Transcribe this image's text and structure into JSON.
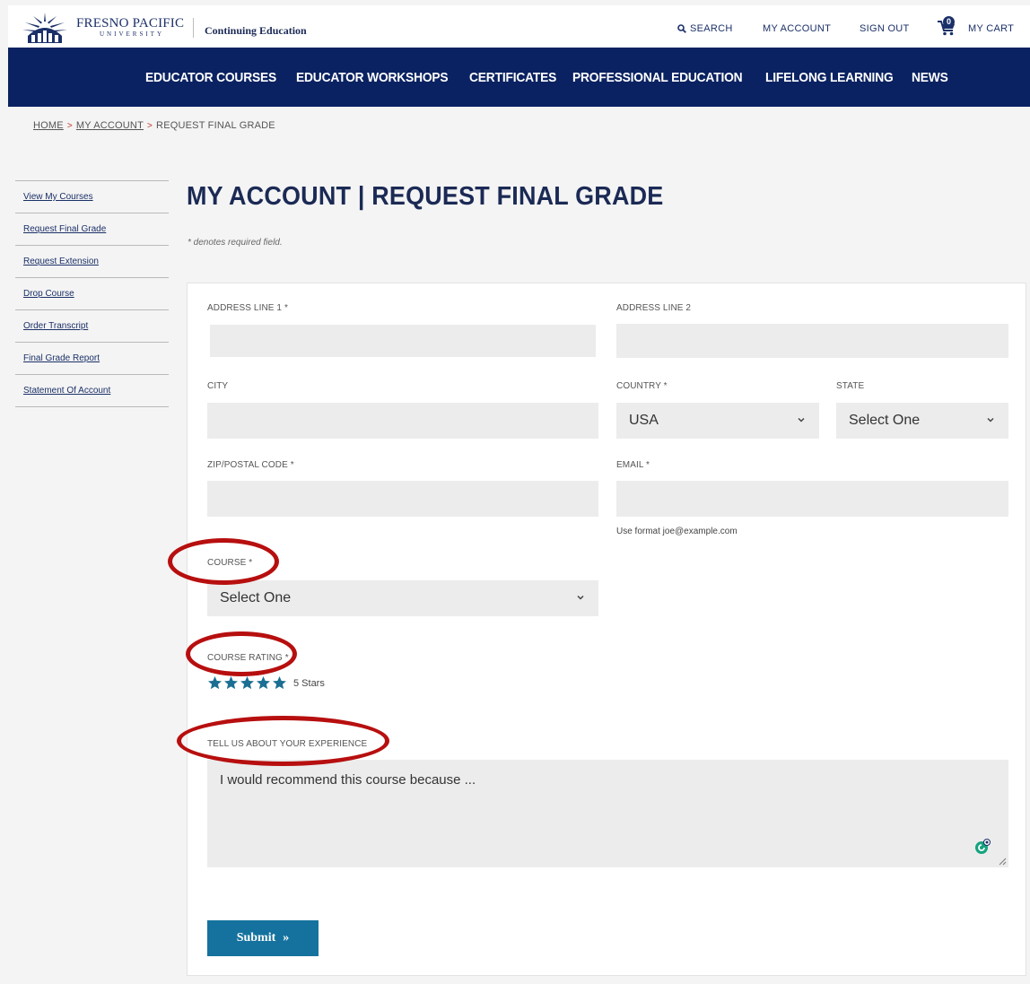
{
  "header": {
    "logo_name": "FRESNO PACIFIC",
    "logo_sub": "UNIVERSITY",
    "division": "Continuing Education",
    "search_label": "SEARCH",
    "account_label": "MY ACCOUNT",
    "signout_label": "SIGN OUT",
    "cart_label": "MY CART",
    "cart_count": "0"
  },
  "nav": {
    "items": [
      {
        "label": "EDUCATOR COURSES"
      },
      {
        "label": "EDUCATOR WORKSHOPS"
      },
      {
        "label": "CERTIFICATES"
      },
      {
        "label": "PROFESSIONAL EDUCATION"
      },
      {
        "label": "LIFELONG LEARNING"
      },
      {
        "label": "NEWS"
      }
    ]
  },
  "breadcrumb": {
    "home": "HOME",
    "account": "MY ACCOUNT",
    "current": "REQUEST FINAL GRADE",
    "separator": ">"
  },
  "sidebar": {
    "items": [
      {
        "label": "View My Courses"
      },
      {
        "label": "Request Final Grade"
      },
      {
        "label": "Request Extension"
      },
      {
        "label": "Drop Course"
      },
      {
        "label": "Order Transcript"
      },
      {
        "label": "Final Grade Report"
      },
      {
        "label": "Statement Of Account"
      }
    ]
  },
  "page": {
    "title": "MY ACCOUNT | REQUEST FINAL GRADE",
    "required_note": "* denotes required field."
  },
  "form": {
    "address1": {
      "label": "ADDRESS LINE 1 *",
      "value": ""
    },
    "address2": {
      "label": "ADDRESS LINE 2",
      "value": ""
    },
    "city": {
      "label": "CITY",
      "value": ""
    },
    "country": {
      "label": "COUNTRY *",
      "selected": "USA"
    },
    "state": {
      "label": "STATE",
      "selected": "Select One"
    },
    "zip": {
      "label": "ZIP/POSTAL CODE *",
      "value": ""
    },
    "email": {
      "label": "EMAIL *",
      "value": "",
      "hint": "Use format joe@example.com"
    },
    "course": {
      "label": "COURSE *",
      "selected": "Select One"
    },
    "rating": {
      "label": "COURSE RATING *",
      "value": 5,
      "max": 5,
      "text": "5 Stars"
    },
    "experience": {
      "label": "TELL US ABOUT YOUR EXPERIENCE",
      "placeholder": "I would recommend this course because ..."
    },
    "submit_label": "Submit",
    "submit_arrow": "»"
  },
  "colors": {
    "nav_bg": "#0a2261",
    "brand": "#1b3068",
    "submit_bg": "#15729e",
    "star": "#1a6f93",
    "annotation": "#b70f0f",
    "field_bg": "#ececec"
  }
}
